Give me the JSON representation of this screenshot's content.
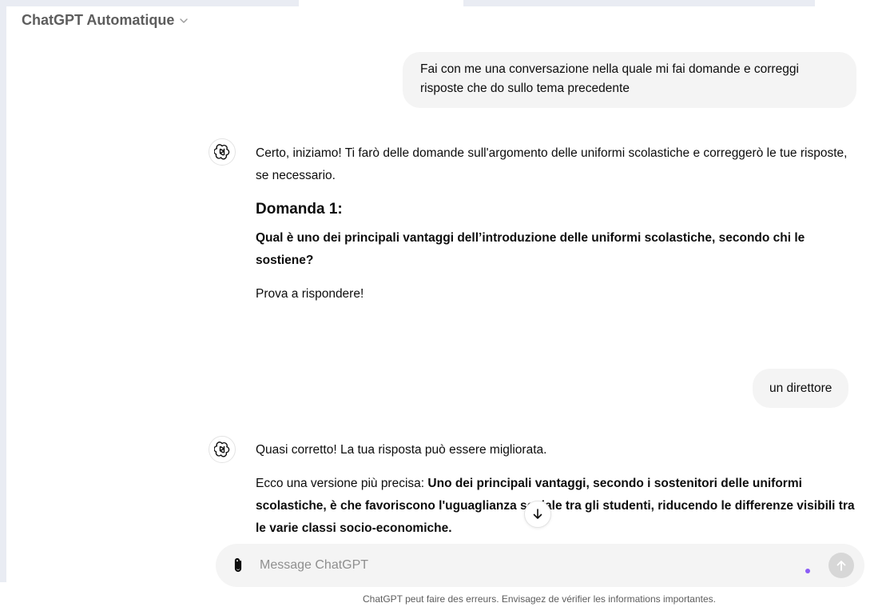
{
  "header": {
    "model_name": "ChatGPT Automatique"
  },
  "messages": [
    {
      "role": "user",
      "text": "Fai con me una conversazione nella quale mi fai domande e correggi risposte che do sullo tema precedente"
    },
    {
      "role": "assistant",
      "intro": "Certo, iniziamo! Ti farò delle domande sull'argomento delle uniformi scolastiche e correggerò le tue risposte, se necessario.",
      "heading": "Domanda 1:",
      "question": "Qual è uno dei principali vantaggi dell’introduzione delle uniformi scolastiche, secondo chi le sostiene?",
      "closing": "Prova a rispondere!"
    },
    {
      "role": "user",
      "text": "un direttore"
    },
    {
      "role": "assistant",
      "intro": "Quasi corretto! La tua risposta può essere migliorata.",
      "prefix": "Ecco una versione più precisa: ",
      "bold": "Uno dei principali vantaggi, secondo i sostenitori delle uniformi scolastiche, è che favoriscono l'uguaglianza sociale tra gli studenti, riducendo le differenze visibili tra le varie classi socio-economiche."
    }
  ],
  "composer": {
    "placeholder": "Message ChatGPT"
  },
  "footer": {
    "disclaimer": "ChatGPT peut faire des erreurs. Envisagez de vérifier les informations importantes."
  },
  "icons": {
    "model_chevron": "chevron-down-icon",
    "assistant_avatar": "openai-logo-icon",
    "scroll": "arrow-down-icon",
    "attach": "paperclip-icon",
    "send": "arrow-up-icon"
  },
  "colors": {
    "user_bubble": "#f4f4f4",
    "accent_dot": "#8b5cf6",
    "send_disabled": "#d7d7d7"
  }
}
